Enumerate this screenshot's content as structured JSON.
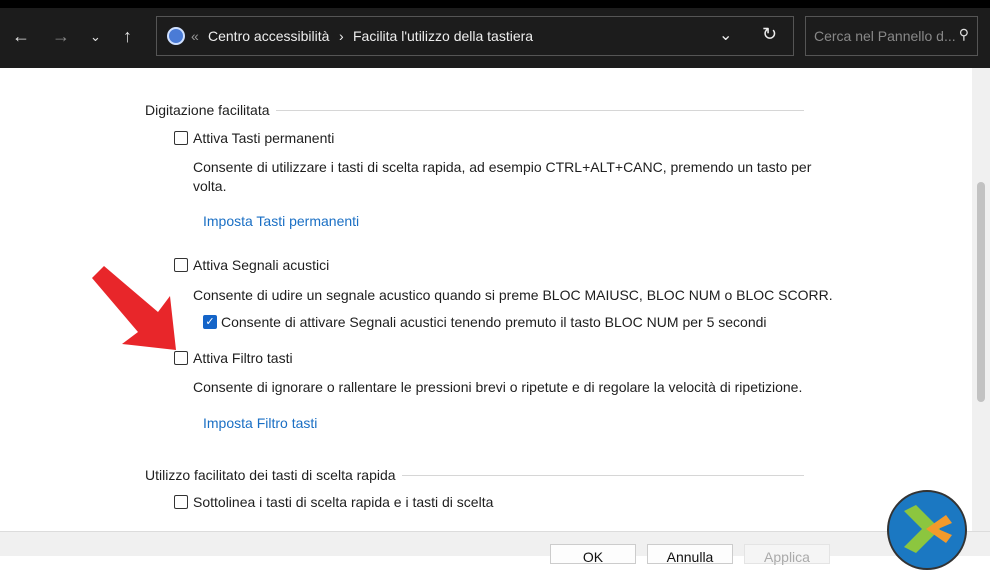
{
  "nav": {
    "breadcrumb_sep": "«",
    "crumb1": "Centro accessibilità",
    "crumb_arrow": "›",
    "crumb2": "Facilita l'utilizzo della tastiera",
    "search_placeholder": "Cerca nel Pannello d..."
  },
  "sections": {
    "typing": {
      "title": "Digitazione facilitata",
      "sticky": {
        "label": "Attiva Tasti permanenti",
        "checked": false,
        "desc1": "Consente di utilizzare i tasti di scelta rapida, ad esempio CTRL+ALT+CANC, premendo un tasto per",
        "desc2": "volta.",
        "link": "Imposta Tasti permanenti"
      },
      "toggle": {
        "label": "Attiva Segnali acustici",
        "checked": false,
        "desc": "Consente di udire un segnale acustico quando si preme BLOC MAIUSC, BLOC NUM o BLOC SCORR.",
        "sub_label": "Consente di attivare Segnali acustici tenendo premuto il tasto BLOC NUM per 5 secondi",
        "sub_checked": true
      },
      "filter": {
        "label": "Attiva Filtro tasti",
        "checked": false,
        "desc": "Consente di ignorare o rallentare le pressioni brevi o ripetute e di regolare la velocità di ripetizione.",
        "link": "Imposta Filtro tasti"
      }
    },
    "shortcuts": {
      "title": "Utilizzo facilitato dei tasti di scelta rapida",
      "underline": {
        "label": "Sottolinea i tasti di scelta rapida e i tasti di scelta",
        "checked": false
      }
    }
  },
  "footer": {
    "ok": "OK",
    "cancel": "Annulla",
    "apply": "Applica"
  },
  "colors": {
    "arrow": "#e8262a",
    "link": "#1a6fc4",
    "check": "#1464c8"
  }
}
